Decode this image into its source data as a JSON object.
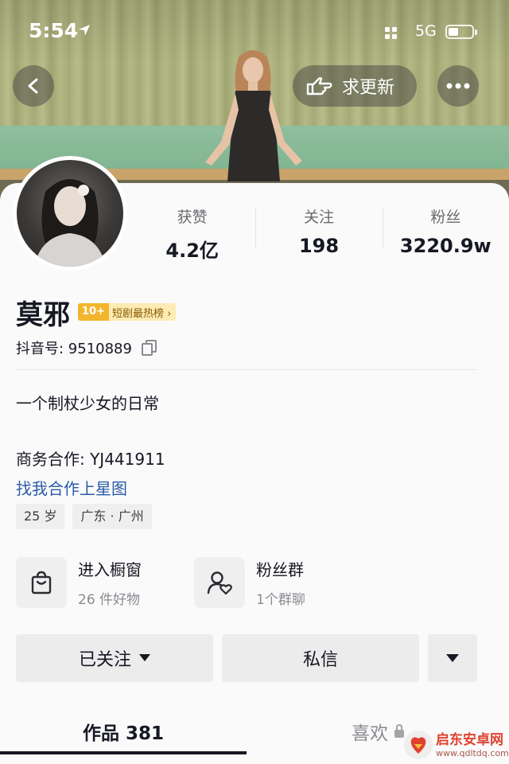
{
  "status_bar": {
    "time": "5:54",
    "network": "5G"
  },
  "header": {
    "update_label": "求更新"
  },
  "profile": {
    "stats": [
      {
        "label": "获赞",
        "value": "4.2亿"
      },
      {
        "label": "关注",
        "value": "198"
      },
      {
        "label": "粉丝",
        "value": "3220.9w"
      }
    ],
    "name": "莫邪",
    "rank_badge": {
      "number": "10+",
      "text": "短剧最热榜 ›"
    },
    "douyin_id": "抖音号: 9510889",
    "bio": "一个制杖少女的日常",
    "business": "商务合作: YJ441911",
    "star_link": "找我合作上星图",
    "tags": [
      "25 岁",
      "广东 · 广州"
    ]
  },
  "features": {
    "shop": {
      "title": "进入橱窗",
      "subtitle": "26 件好物"
    },
    "fans": {
      "title": "粉丝群",
      "subtitle": "1个群聊"
    }
  },
  "actions": {
    "follow": "已关注",
    "message": "私信"
  },
  "tabs": {
    "works": "作品 381",
    "likes": "喜欢"
  },
  "watermark": {
    "line1": "启东安卓网",
    "line2": "www.qdltdq.com"
  }
}
